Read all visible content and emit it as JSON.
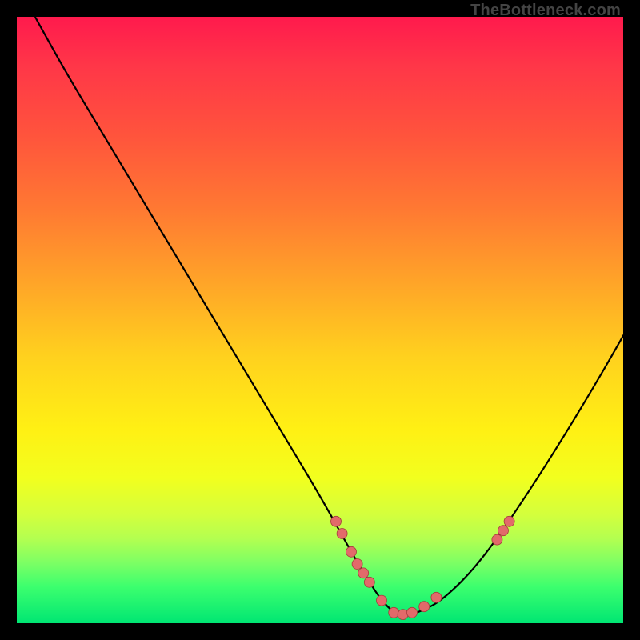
{
  "watermark": "TheBottleneck.com",
  "colors": {
    "gradient_top": "#ff1a4d",
    "gradient_mid": "#ffd11e",
    "gradient_bottom": "#00e673",
    "curve": "#000000",
    "dot_fill": "#e26a6a",
    "dot_stroke": "#a63c3c"
  },
  "chart_data": {
    "type": "line",
    "title": "",
    "xlabel": "",
    "ylabel": "",
    "xlim": [
      0,
      100
    ],
    "ylim": [
      0,
      100
    ],
    "grid": false,
    "legend": false,
    "series": [
      {
        "name": "bottleneck-curve",
        "x": [
          3,
          8,
          14,
          20,
          26,
          32,
          38,
          44,
          50,
          55,
          58,
          60,
          62,
          64,
          66,
          70,
          76,
          83,
          90,
          96,
          100
        ],
        "y": [
          100,
          91,
          81,
          71,
          61,
          51,
          41,
          31,
          21,
          12,
          7,
          4,
          2,
          1.6,
          2,
          4,
          10,
          20,
          31,
          41,
          48
        ]
      }
    ],
    "scatter": [
      {
        "name": "markers",
        "x": [
          52.5,
          53.5,
          55,
          56,
          57,
          58,
          60,
          62,
          63.5,
          65,
          67,
          69,
          79,
          80,
          81
        ],
        "y": [
          17,
          15,
          12,
          10,
          8.5,
          7,
          4,
          2,
          1.7,
          2,
          3,
          4.5,
          14,
          15.5,
          17
        ]
      }
    ]
  }
}
